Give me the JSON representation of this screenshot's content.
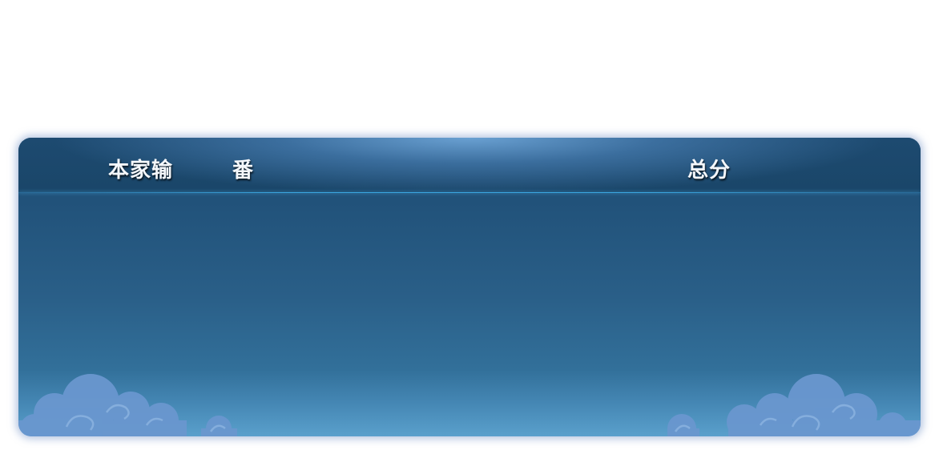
{
  "score_table": {
    "columns": [
      "本家输",
      "番",
      "总分"
    ]
  },
  "colors": {
    "panel_top": "#1f4f74",
    "panel_bottom": "#5aa0cc",
    "header_glow": "#6ea5d7",
    "header_line": "#3aa6e0",
    "cloud": "#6a97cf",
    "label_text": "#f4f7fb"
  },
  "decor": [
    "cloud-left-icon",
    "cloud-right-icon"
  ]
}
